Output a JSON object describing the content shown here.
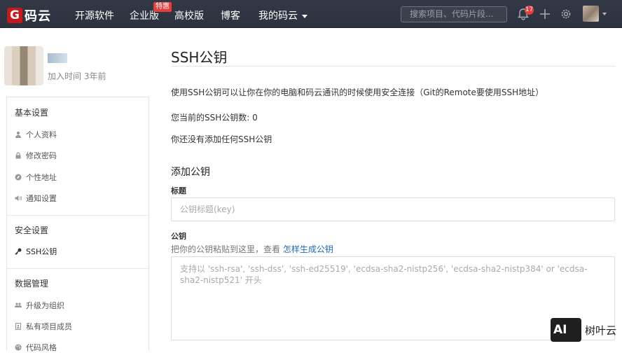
{
  "brand": {
    "mark": "G",
    "name": "码云"
  },
  "nav": {
    "open_source": "开源软件",
    "enterprise": "企业版",
    "enterprise_badge": "特惠",
    "university": "高校版",
    "blog": "博客",
    "my_gitee": "我的码云"
  },
  "search": {
    "placeholder": "搜索项目、代码片段..."
  },
  "notifications": {
    "count": "17"
  },
  "profile": {
    "join_time": "加入时间 3年前"
  },
  "sidebar": {
    "basic_settings": "基本设置",
    "personal_info": "个人资料",
    "change_password": "修改密码",
    "personal_url": "个性地址",
    "notification_settings": "通知设置",
    "security_settings": "安全设置",
    "ssh_keys": "SSH公钥",
    "data_management": "数据管理",
    "upgrade_org": "升级为组织",
    "private_members": "私有项目成员",
    "code_style": "代码风格"
  },
  "main": {
    "title": "SSH公钥",
    "description": "使用SSH公钥可以让你在你的电脑和码云通讯的时候使用安全连接（Git的Remote要使用SSH地址）",
    "key_count": "您当前的SSH公钥数: 0",
    "no_keys": "你还没有添加任何SSH公钥",
    "add_heading": "添加公钥",
    "title_label": "标题",
    "title_placeholder": "公钥标题(key)",
    "key_label": "公钥",
    "key_hint": "把你的公钥粘贴到这里，查看",
    "key_hint_link": "怎样生成公钥",
    "key_placeholder": "支持以 'ssh-rsa', 'ssh-dss', 'ssh-ed25519', 'ecdsa-sha2-nistp256', 'ecdsa-sha2-nistp384' or 'ecdsa-sha2-nistp521' 开头"
  },
  "watermark": {
    "logo": "AI",
    "text": "树叶云"
  },
  "colors": {
    "topbar": "#2f3542",
    "brand_red": "#c7191b",
    "link": "#1a6dbd",
    "badge_red": "#e63e3e"
  }
}
